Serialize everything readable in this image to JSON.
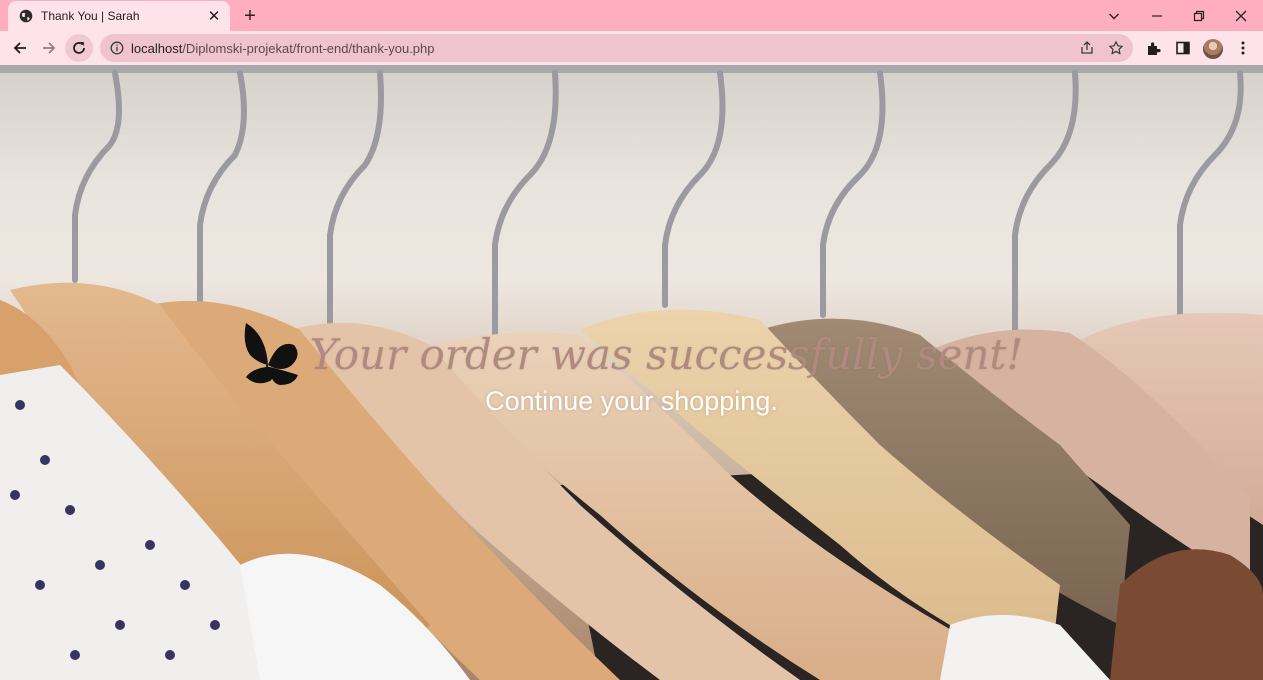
{
  "browser": {
    "tab": {
      "title": "Thank You | Sarah",
      "favicon": "globe-icon"
    },
    "address_bar": {
      "url_host": "localhost",
      "url_path": "/Diplomski-projekat/front-end/thank-you.php"
    },
    "colors": {
      "tabstrip": "#ffaec0",
      "toolbar": "#ffe3ea",
      "omnibox": "#efc4ce"
    }
  },
  "page": {
    "background_image": "clothes-on-wooden-hangers",
    "logo_icon": "butterfly-icon",
    "headline": "Your order was successfully sent!",
    "subline": "Continue your shopping.",
    "colors": {
      "headline": "#b08a80",
      "subline": "#ffffff"
    }
  }
}
